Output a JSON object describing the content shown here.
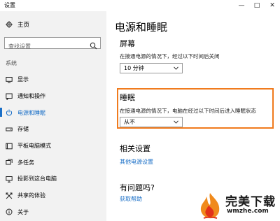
{
  "window": {
    "title": "设置",
    "controls": [
      "—",
      "□",
      "✕"
    ]
  },
  "sidebar": {
    "home_label": "主页",
    "search_placeholder": "查找设置",
    "section_label": "系统",
    "items": [
      {
        "label": "显示",
        "icon": "monitor-icon"
      },
      {
        "label": "通知和操作",
        "icon": "notification-icon"
      },
      {
        "label": "电源和睡眠",
        "icon": "power-icon",
        "active": true
      },
      {
        "label": "存储",
        "icon": "storage-icon"
      },
      {
        "label": "平板电脑模式",
        "icon": "tablet-icon"
      },
      {
        "label": "多任务",
        "icon": "multitask-icon"
      },
      {
        "label": "投影到这台电脑",
        "icon": "project-icon"
      },
      {
        "label": "共享的体验",
        "icon": "share-icon"
      },
      {
        "label": "关于",
        "icon": "info-icon"
      }
    ]
  },
  "main": {
    "title": "电源和睡眠",
    "screen": {
      "heading": "屏幕",
      "desc": "在接通电源的情况下，经过以下时间后关闭",
      "value": "10 分钟"
    },
    "sleep": {
      "heading": "睡眠",
      "desc": "在接通电源的情况下，电脑在经过以下时间后进入睡眠状态",
      "value": "从不"
    },
    "related": {
      "heading": "相关设置",
      "link": "其他电源设置"
    },
    "help": {
      "heading": "有问题吗?",
      "link": "获取帮助"
    }
  },
  "watermark": {
    "text": "完美下载",
    "url": "wmzhe.com"
  },
  "colors": {
    "accent": "#1a6fc7",
    "highlight": "#f07b1e",
    "sidebar_bg": "#f2f2f2"
  }
}
